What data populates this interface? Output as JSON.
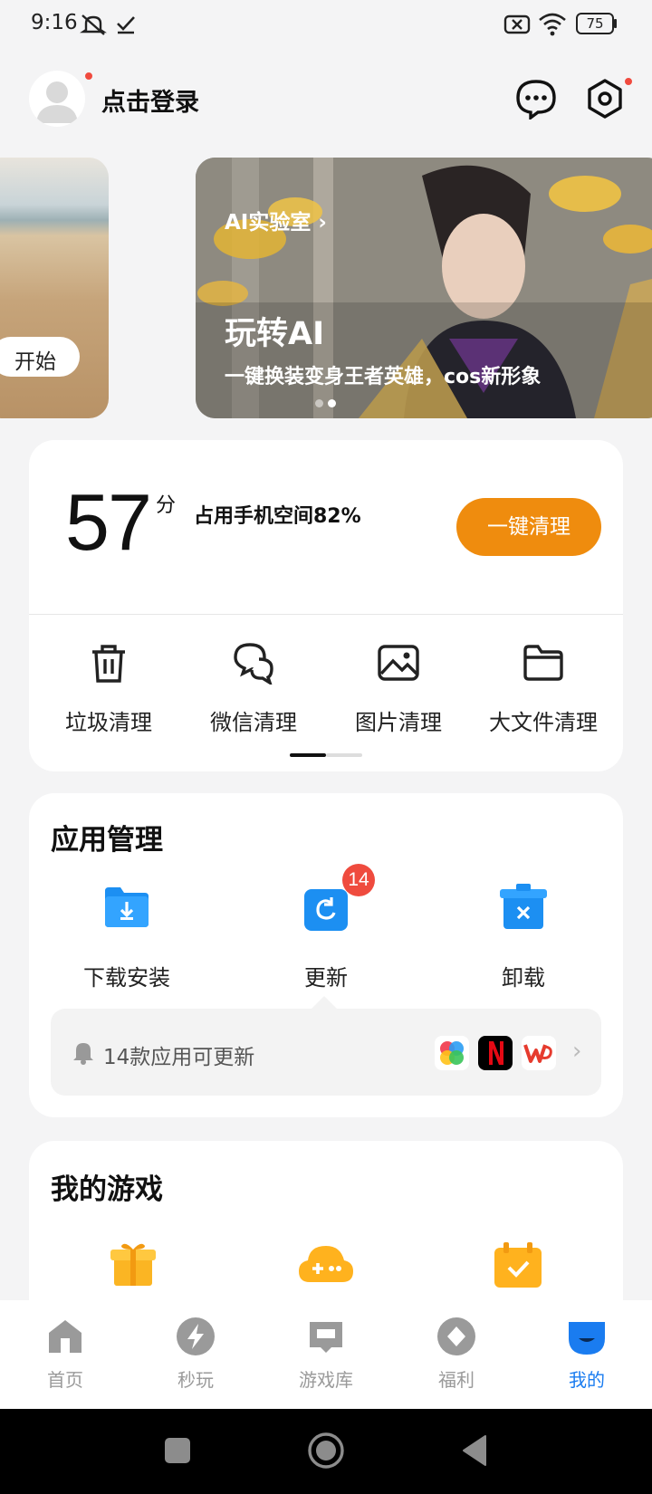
{
  "status_bar": {
    "time": "9:16",
    "battery": "75"
  },
  "header": {
    "login_label": "点击登录"
  },
  "banners": {
    "left_button": "开始",
    "main": {
      "tag": "AI实验室",
      "title": "玩转AI",
      "subtitle": "一键换装变身王者英雄，cos新形象"
    }
  },
  "clean": {
    "score": "57",
    "score_unit": "分",
    "space_text": "占用手机空间82%",
    "clean_button": "一键清理",
    "tools": [
      {
        "label": "垃圾清理",
        "icon": "trash-icon"
      },
      {
        "label": "微信清理",
        "icon": "wechat-icon"
      },
      {
        "label": "图片清理",
        "icon": "image-icon"
      },
      {
        "label": "大文件清理",
        "icon": "folder-icon"
      }
    ]
  },
  "apps": {
    "title": "应用管理",
    "items": [
      {
        "label": "下载安装",
        "icon": "download-folder-icon"
      },
      {
        "label": "更新",
        "icon": "update-icon",
        "badge": "14"
      },
      {
        "label": "卸载",
        "icon": "uninstall-icon"
      }
    ],
    "notice": "14款应用可更新"
  },
  "games": {
    "title": "我的游戏"
  },
  "nav": {
    "items": [
      {
        "label": "首页",
        "icon": "home-icon"
      },
      {
        "label": "秒玩",
        "icon": "lightning-icon"
      },
      {
        "label": "游戏库",
        "icon": "game-library-icon"
      },
      {
        "label": "福利",
        "icon": "gift-diamond-icon"
      },
      {
        "label": "我的",
        "icon": "profile-icon",
        "active": true
      }
    ],
    "active_color": "#1a7cf0",
    "inactive_color": "#9a9a9a"
  },
  "colors": {
    "accent_orange": "#ef8c0e",
    "badge_red": "#ef4b3e",
    "blue": "#1a7cf0"
  }
}
